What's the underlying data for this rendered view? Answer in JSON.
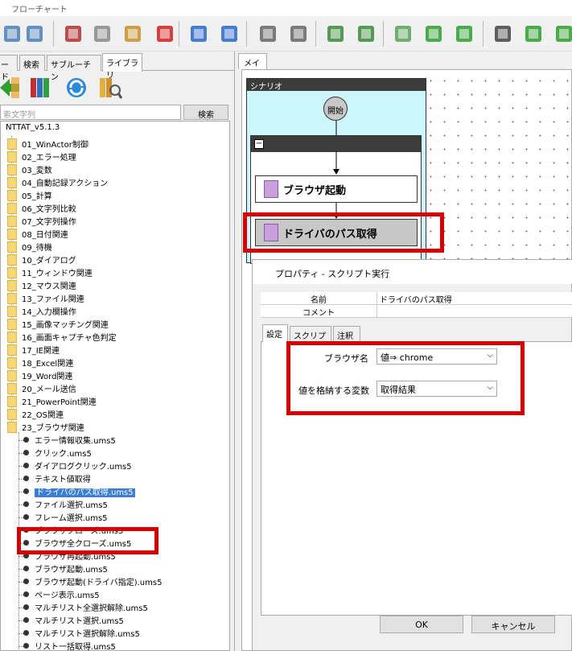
{
  "window": {
    "title": "フローチャート"
  },
  "toolbar": {
    "buttons": [
      "image-icon",
      "image-icon",
      "cut-icon",
      "copy-icon",
      "paste-icon",
      "delete-icon",
      "undo-icon",
      "redo-icon",
      "zoom-in-icon",
      "zoom-out-icon",
      "export-image-icon",
      "import-image-icon",
      "insert-node-icon",
      "arrow-left-icon",
      "arrow-right-icon",
      "windows-icon",
      "add-icon",
      "arrow-green-icon"
    ]
  },
  "left_panel": {
    "tabs": [
      "ード",
      "検索",
      "サブルーチン",
      "ライブラリ"
    ],
    "active_tab": "ライブラリ",
    "search_placeholder": "索文字列",
    "search_button": "検索",
    "tree_root": "NTTAT_v5.1.3",
    "folders": [
      "01_WinActor制御",
      "02_エラー処理",
      "03_変数",
      "04_自動記録アクション",
      "05_計算",
      "06_文字列比較",
      "07_文字列操作",
      "08_日付関連",
      "09_待機",
      "10_ダイアログ",
      "11_ウィンドウ関連",
      "12_マウス関連",
      "13_ファイル関連",
      "14_入力欄操作",
      "15_画像マッチング関連",
      "16_画面キャプチャ色判定",
      "17_IE関連",
      "18_Excel関連",
      "19_Word関連",
      "20_メール送信",
      "21_PowerPoint関連",
      "22_OS関連",
      "23_ブラウザ関連"
    ],
    "items": [
      "エラー情報収集.ums5",
      "クリック.ums5",
      "ダイアログクリック.ums5",
      "テキスト値取得",
      "ドライバのパス取得.ums5",
      "ファイル選択.ums5",
      "フレーム選択.ums5",
      "ブラウザクローズ.ums5",
      "ブラウザ全クローズ.ums5",
      "ブラウザ再起動.ums5",
      "ブラウザ起動.ums5",
      "ブラウザ起動(ドライバ指定).ums5",
      "ページ表示.ums5",
      "マルチリスト全選択解除.ums5",
      "マルチリスト選択.ums5",
      "マルチリスト選択解除.ums5",
      "リスト一括取得.ums5"
    ],
    "selected_item": "ドライバのパス取得.ums5"
  },
  "main": {
    "tab": "メイン",
    "scenario_label": "シナリオ",
    "start_label": "開始",
    "group_collapse": "−",
    "nodes": [
      "ブラウザ起動",
      "ドライバのパス取得"
    ]
  },
  "dialog": {
    "title": "プロパティ - スクリプト実行",
    "name_key": "名前",
    "name_value": "ドライバのパス取得",
    "comment_key": "コメント",
    "comment_value": "",
    "tabs": [
      "設定",
      "スクリプト",
      "注釈"
    ],
    "active_tab": "設定",
    "fields": [
      {
        "label": "ブラウザ名",
        "value": "値⇒ chrome"
      },
      {
        "label": "値を格納する変数",
        "value": "取得結果"
      }
    ],
    "ok": "OK",
    "cancel": "キャンセル"
  },
  "colors": {
    "highlight": "#d40000",
    "selection": "#3a7fd5",
    "scenario_bg": "#ccf6fb"
  }
}
